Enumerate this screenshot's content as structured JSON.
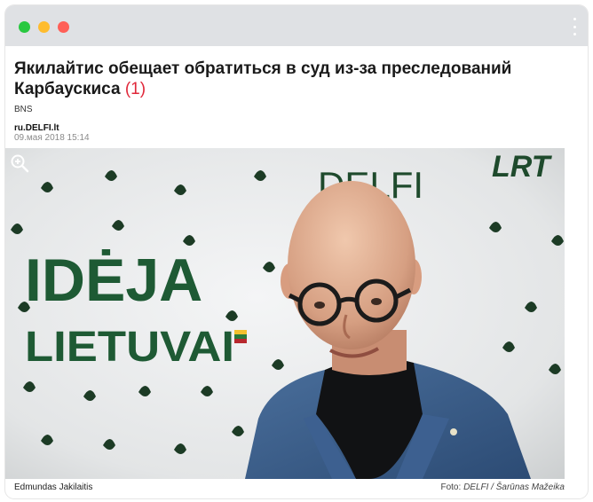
{
  "window": {
    "controls": {
      "close_color": "#28c840",
      "minimize_color": "#febc2e",
      "maximize_color": "#ff5f57"
    },
    "menu_icon": "kebab-menu-icon"
  },
  "article": {
    "title": "Якилайтис обещает обратиться в суд из-за преследований Карбаускиса",
    "comment_count": "(1)",
    "source": "BNS",
    "site": "ru.DELFI.lt",
    "datetime": "09.мая 2018 15:14",
    "accent_color": "#e0283a"
  },
  "photo": {
    "zoom_icon": "zoom-in-icon",
    "backdrop_text": {
      "brand1": "DELFI",
      "brand2": "LRT",
      "word1": "IDĖJA",
      "word2": "LIETUVAI"
    },
    "caption": "Edmundas Jakilaitis",
    "credit_prefix": "Foto: ",
    "credit": "DELFI / Šarūnas Mažeika"
  }
}
